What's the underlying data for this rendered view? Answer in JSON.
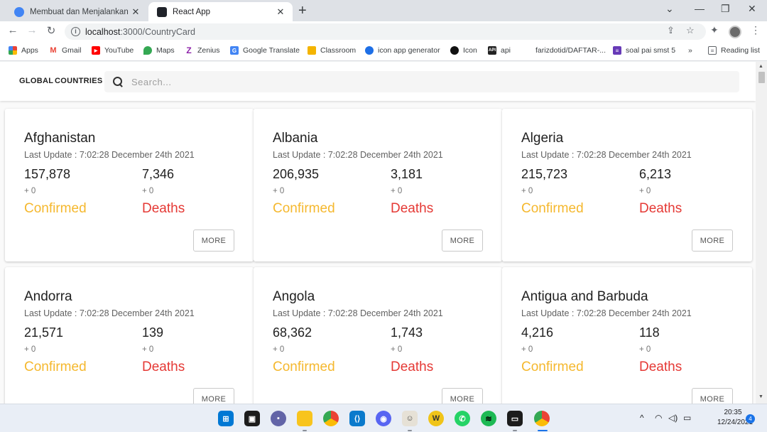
{
  "browser": {
    "tabs": [
      {
        "title": "Membuat dan Menjalankan Proje",
        "favicon": "circle-favicon-icon",
        "active": false
      },
      {
        "title": "React App",
        "favicon": "react-favicon-icon",
        "active": true
      }
    ],
    "url": {
      "host": "localhost",
      "path": ":3000/CountryCard"
    },
    "bookmarks": [
      {
        "label": "Apps",
        "icon": "apps-grid-icon"
      },
      {
        "label": "Gmail",
        "icon": "gmail-icon"
      },
      {
        "label": "YouTube",
        "icon": "youtube-icon"
      },
      {
        "label": "Maps",
        "icon": "maps-icon"
      },
      {
        "label": "Zenius",
        "icon": "zenius-icon"
      },
      {
        "label": "Google Translate",
        "icon": "translate-icon"
      },
      {
        "label": "Classroom",
        "icon": "classroom-icon"
      },
      {
        "label": "icon app generator",
        "icon": "generator-icon"
      },
      {
        "label": "Icon",
        "icon": "github-icon"
      },
      {
        "label": "api",
        "icon": "api-icon"
      },
      {
        "label": "farizdotid/DAFTAR-...",
        "icon": "github-icon"
      },
      {
        "label": "soal pai smst 5",
        "icon": "forms-icon"
      }
    ],
    "bookmarks_overflow": "»",
    "reading_list": "Reading list"
  },
  "app": {
    "nav": {
      "global": "GLOBAL",
      "countries": "COUNTRIES"
    },
    "search": {
      "placeholder": "Search..."
    },
    "cards": [
      {
        "country": "Afghanistan",
        "update": "Last Update : 7:02:28 December 24th 2021",
        "confirmed": "157,878",
        "deaths": "7,346",
        "confirmed_delta": "+ 0",
        "deaths_delta": "+ 0",
        "confirmed_label": "Confirmed",
        "deaths_label": "Deaths",
        "more": "MORE"
      },
      {
        "country": "Albania",
        "update": "Last Update : 7:02:28 December 24th 2021",
        "confirmed": "206,935",
        "deaths": "3,181",
        "confirmed_delta": "+ 0",
        "deaths_delta": "+ 0",
        "confirmed_label": "Confirmed",
        "deaths_label": "Deaths",
        "more": "MORE"
      },
      {
        "country": "Algeria",
        "update": "Last Update : 7:02:28 December 24th 2021",
        "confirmed": "215,723",
        "deaths": "6,213",
        "confirmed_delta": "+ 0",
        "deaths_delta": "+ 0",
        "confirmed_label": "Confirmed",
        "deaths_label": "Deaths",
        "more": "MORE"
      },
      {
        "country": "Andorra",
        "update": "Last Update : 7:02:28 December 24th 2021",
        "confirmed": "21,571",
        "deaths": "139",
        "confirmed_delta": "+ 0",
        "deaths_delta": "+ 0",
        "confirmed_label": "Confirmed",
        "deaths_label": "Deaths",
        "more": "MORE"
      },
      {
        "country": "Angola",
        "update": "Last Update : 7:02:28 December 24th 2021",
        "confirmed": "68,362",
        "deaths": "1,743",
        "confirmed_delta": "+ 0",
        "deaths_delta": "+ 0",
        "confirmed_label": "Confirmed",
        "deaths_label": "Deaths",
        "more": "MORE"
      },
      {
        "country": "Antigua and Barbuda",
        "update": "Last Update : 7:02:28 December 24th 2021",
        "confirmed": "4,216",
        "deaths": "118",
        "confirmed_delta": "+ 0",
        "deaths_delta": "+ 0",
        "confirmed_label": "Confirmed",
        "deaths_label": "Deaths",
        "more": "MORE"
      }
    ],
    "colors": {
      "confirmed": "#f5b82e",
      "deaths": "#e53935"
    }
  },
  "taskbar": {
    "apps": [
      "windows-start-icon",
      "task-view-icon",
      "teams-chat-icon",
      "file-explorer-icon",
      "chrome-icon",
      "vscode-icon",
      "discord-icon",
      "game-icon",
      "word-icon",
      "whatsapp-icon",
      "spotify-icon",
      "terminal-icon",
      "chrome-active-icon"
    ],
    "time": "20:35",
    "date": "12/24/2021",
    "notifications": "4"
  }
}
